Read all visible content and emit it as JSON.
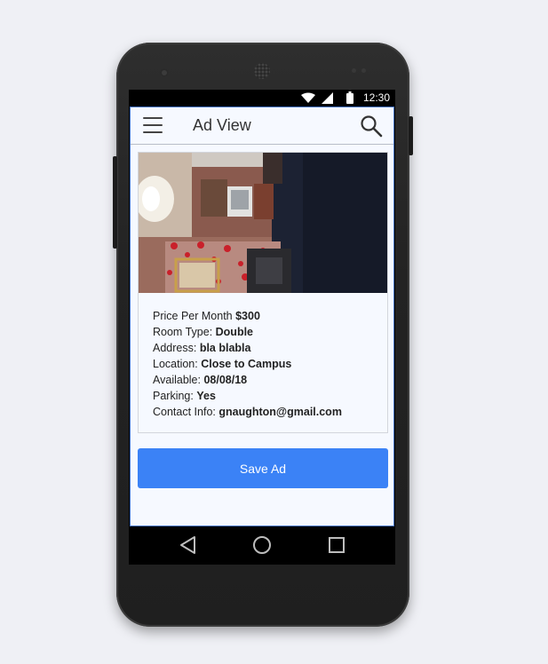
{
  "statusbar": {
    "time": "12:30"
  },
  "toolbar": {
    "title": "Ad View"
  },
  "ad": {
    "details": [
      {
        "label": "Price Per Month ",
        "value": "$300"
      },
      {
        "label": "Room Type: ",
        "value": "Double"
      },
      {
        "label": "Address: ",
        "value": "bla blabla"
      },
      {
        "label": "Location: ",
        "value": "Close to Campus"
      },
      {
        "label": "Available: ",
        "value": "08/08/18"
      },
      {
        "label": "Parking: ",
        "value": "Yes"
      },
      {
        "label": "Contact Info: ",
        "value": "gnaughton@gmail.com"
      }
    ],
    "save_label": "Save Ad"
  },
  "icons": {
    "menu": "hamburger-menu-icon",
    "search": "search-icon",
    "back": "back-triangle-icon",
    "home": "home-circle-icon",
    "recents": "recents-square-icon"
  },
  "colors": {
    "accent": "#3b82f6",
    "app_bg": "#f6f9ff"
  }
}
